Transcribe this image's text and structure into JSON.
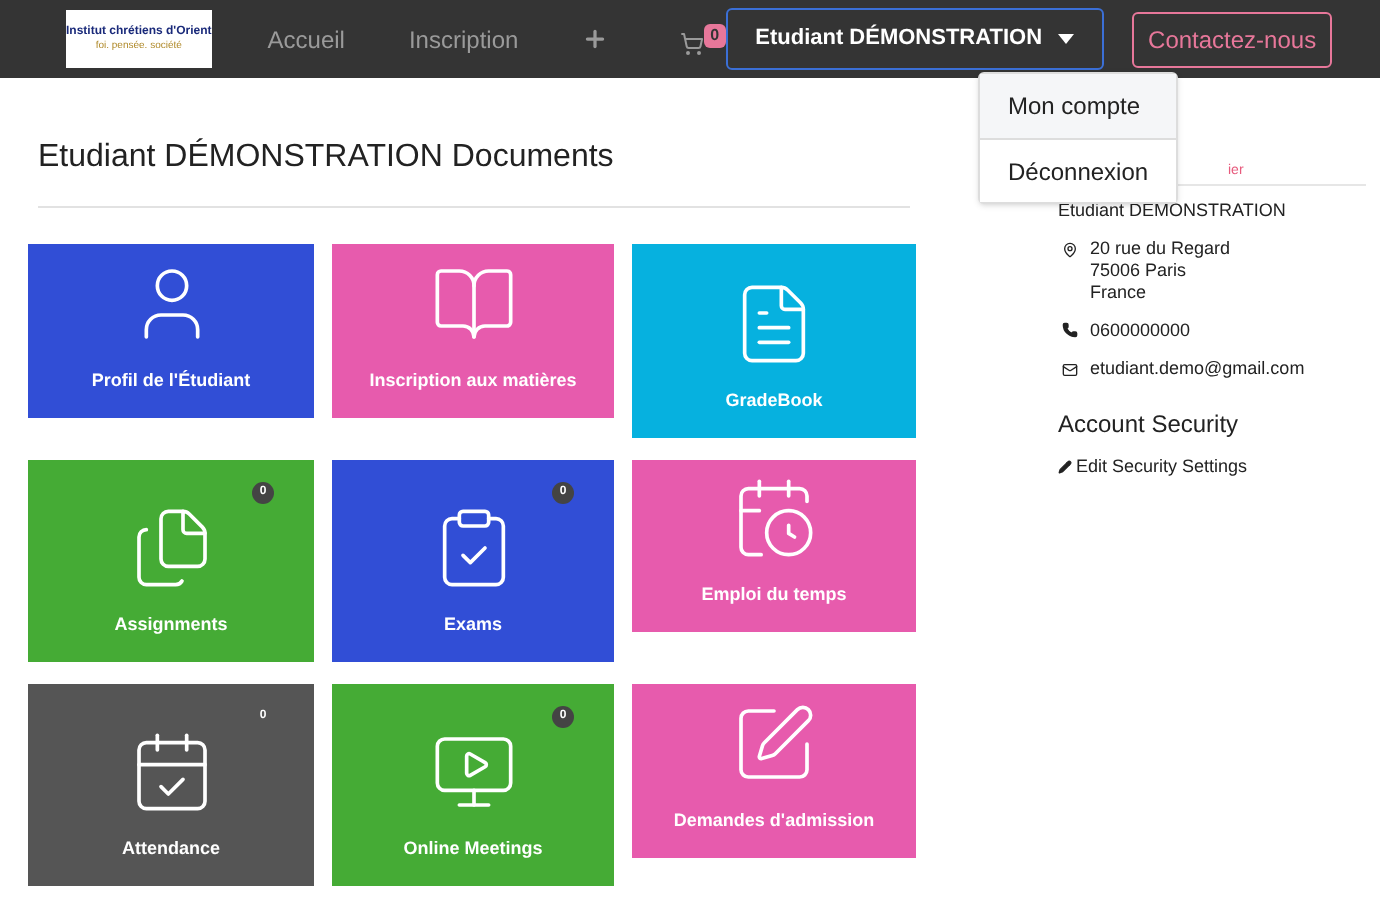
{
  "logo": {
    "line_1": "Institut chrétiens d'Orient",
    "line_2": "foi. pensée. société"
  },
  "nav": [
    {
      "kind": "link",
      "label": "Accueil"
    },
    {
      "kind": "link",
      "label": "Inscription"
    },
    {
      "kind": "plus"
    },
    {
      "kind": "cart",
      "badge": "0"
    }
  ],
  "user_menu": {
    "label": "Etudiant DÉMONSTRATION",
    "expanded": true,
    "items": [
      {
        "label": "Mon compte",
        "selected": true
      },
      {
        "label": "Déconnexion",
        "selected": false
      }
    ]
  },
  "contact_button": "Contactez-nous",
  "page_title": "Etudiant DÉMONSTRATION Documents",
  "tiles": [
    {
      "kind": "profile",
      "label": "Profil de l'Étudiant",
      "color": "#314ed6"
    },
    {
      "kind": "enrolment",
      "label": "Inscription aux matières",
      "color": "#e75bad"
    },
    {
      "kind": "grades",
      "label": "GradeBook",
      "color": "#06b1df"
    },
    {
      "kind": "assignments",
      "label": "Assignments",
      "color": "#45ab35",
      "badge": "0"
    },
    {
      "kind": "exams",
      "label": "Exams",
      "color": "#314ed6",
      "badge": "0"
    },
    {
      "kind": "timetable",
      "label": "Emploi du temps",
      "color": "#e75bad"
    },
    {
      "kind": "attendance",
      "label": "Attendance",
      "color": "#555555",
      "badge": "0"
    },
    {
      "kind": "meetings",
      "label": "Online Meetings",
      "color": "#45ab35",
      "badge": "0"
    },
    {
      "kind": "admission",
      "label": "Demandes d'admission",
      "color": "#e75bad"
    }
  ],
  "profile": {
    "link_fragment": "ier",
    "name": "Etudiant DÉMONSTRATION",
    "address": [
      "20 rue du Regard",
      "75006 Paris",
      "France"
    ],
    "phone": "0600000000",
    "email": "etudiant.demo@gmail.com",
    "security_title": "Account Security",
    "security_link": "Edit Security Settings"
  }
}
